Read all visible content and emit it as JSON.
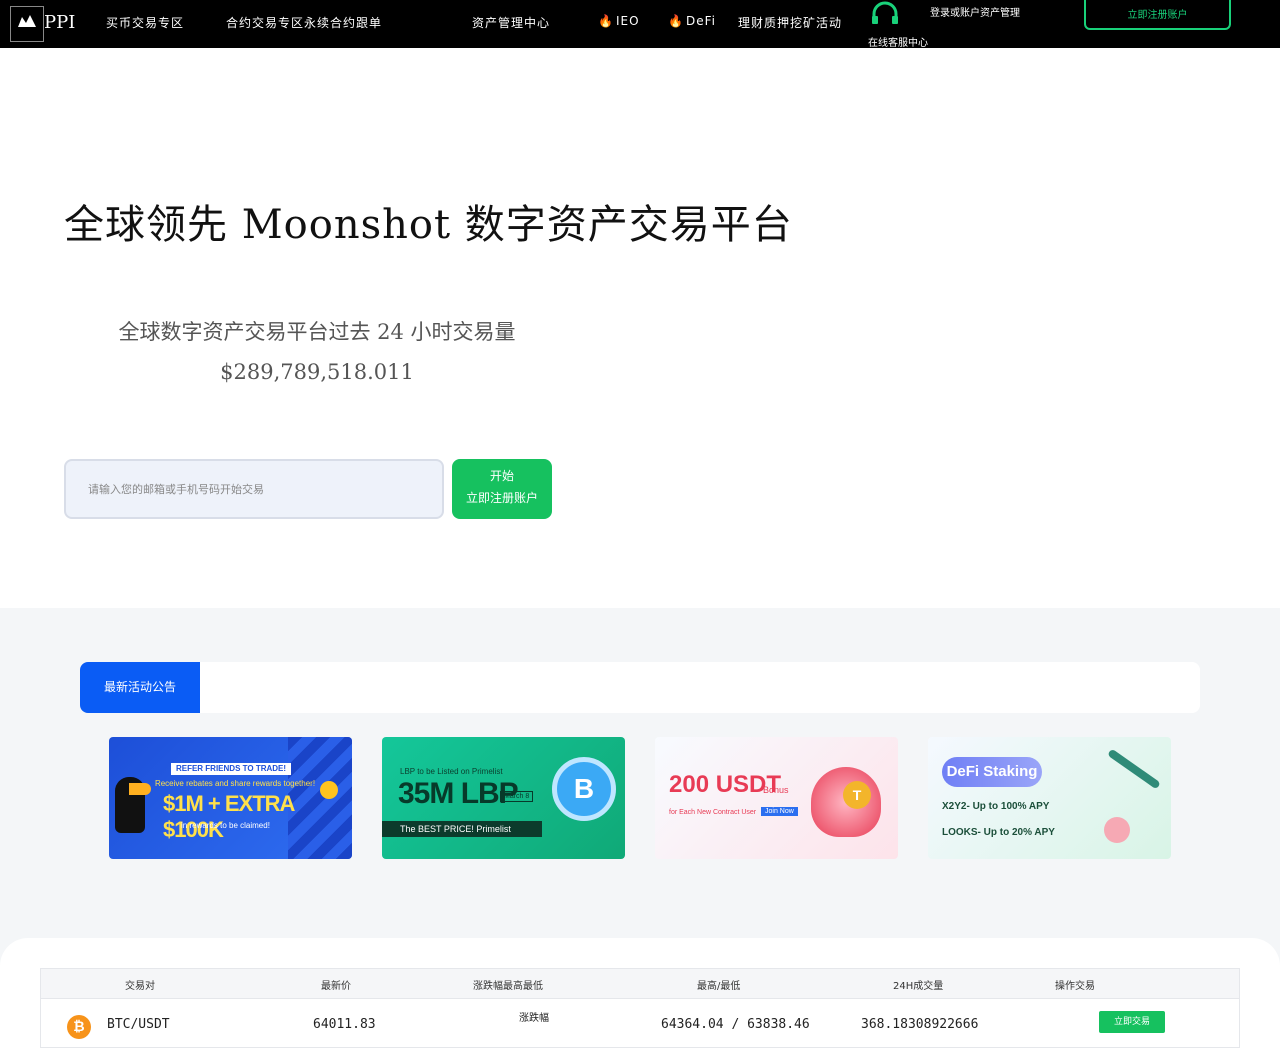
{
  "header": {
    "brand": "PPI",
    "nav": [
      "买币交易专区",
      "合约交易专区永续合约跟单",
      "资产管理中心",
      "IEO",
      "DeFi",
      "理财质押挖矿活动"
    ],
    "support_label": "在线客服中心",
    "login": "登录或账户资产管理",
    "register": "立即注册账户"
  },
  "hero": {
    "title": "全球领先 Moonshot 数字资产交易平台",
    "subtitle": "全球数字资产交易平台过去 24 小时交易量",
    "amount": "$289,789,518.011",
    "email_placeholder": "请输入您的邮箱或手机号码开始交易",
    "start_button_line1": "开始",
    "start_button_line2": "立即注册账户"
  },
  "announcements": {
    "tab_label": "最新活动公告",
    "banners": [
      {
        "top": "REFER FRIENDS TO TRADE!",
        "mid": "Receive rebates and share rewards together!",
        "big": "$1M + EXTRA $100K",
        "small": "in rewards to be claimed!"
      },
      {
        "sub": "LBP to be Listed on Primelist",
        "big": "35M LBP",
        "date": "March 8",
        "strip": "The BEST PRICE!  Primelist"
      },
      {
        "big": "200 USDT",
        "bonus": "Bonus",
        "txt": "for Each New Contract User",
        "join": "Join Now"
      },
      {
        "title": "DeFi Staking",
        "line1": "X2Y2- Up to 100% APY",
        "line2": "LOOKS- Up to 20% APY"
      }
    ]
  },
  "market": {
    "headers": [
      "交易对",
      "最新价",
      "涨跌幅最高最低",
      "最高/最低",
      "24H成交量",
      "操作交易"
    ],
    "rows": [
      {
        "pair": "BTC/USDT",
        "last": "64011.83",
        "change": "涨跌幅",
        "high_low": "64364.04 / 63838.46",
        "volume": "368.18308922666",
        "action": "立即交易"
      }
    ]
  }
}
